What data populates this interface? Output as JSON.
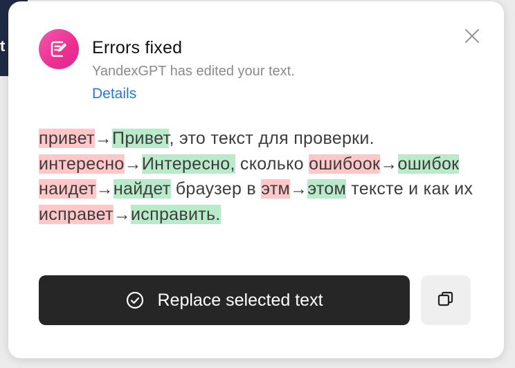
{
  "header": {
    "title": "Errors fixed",
    "subtitle": "YandexGPT has edited your text.",
    "details_link": "Details"
  },
  "icons": {
    "logo": "edit-document-icon",
    "close": "close-icon",
    "check": "check-circle-icon",
    "copy": "copy-icon"
  },
  "colors": {
    "logo_gradient_start": "#f05ab0",
    "logo_gradient_end": "#d62a9a",
    "deletion_highlight": "#ffc7c7",
    "insertion_highlight": "#b9ebcb",
    "link": "#1f7ad6",
    "primary_button": "#262626"
  },
  "correction": {
    "arrow": "→",
    "segments": [
      {
        "type": "del",
        "text": "привет"
      },
      {
        "type": "arrow",
        "text": "→"
      },
      {
        "type": "ins",
        "text": "Привет"
      },
      {
        "type": "plain",
        "text": ", это текст для проверки. "
      },
      {
        "type": "del",
        "text": "интересно"
      },
      {
        "type": "arrow",
        "text": "→"
      },
      {
        "type": "ins",
        "text": "Интересно,"
      },
      {
        "type": "plain",
        "text": " сколько "
      },
      {
        "type": "del",
        "text": "ошибоок"
      },
      {
        "type": "arrow",
        "text": "→"
      },
      {
        "type": "ins",
        "text": "ошибок"
      },
      {
        "type": "plain",
        "text": " "
      },
      {
        "type": "del",
        "text": "наидет"
      },
      {
        "type": "arrow",
        "text": "→"
      },
      {
        "type": "ins",
        "text": "найдет"
      },
      {
        "type": "plain",
        "text": " браузер в "
      },
      {
        "type": "del",
        "text": "этм"
      },
      {
        "type": "arrow",
        "text": "→"
      },
      {
        "type": "ins",
        "text": "этом"
      },
      {
        "type": "plain",
        "text": " тексте и как их "
      },
      {
        "type": "del",
        "text": "исправет"
      },
      {
        "type": "arrow",
        "text": "→"
      },
      {
        "type": "ins",
        "text": "исправить."
      }
    ]
  },
  "actions": {
    "replace_label": "Replace selected text"
  }
}
